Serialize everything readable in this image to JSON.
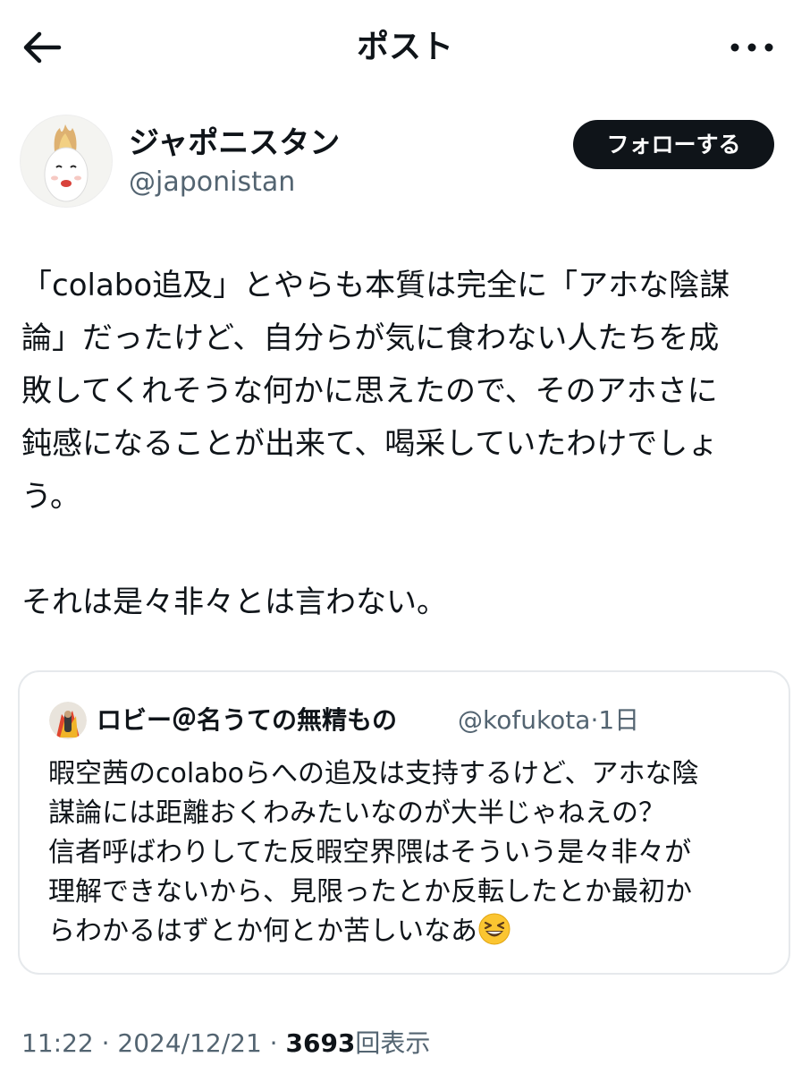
{
  "header": {
    "title": "ポスト",
    "back_icon": "arrow-left-icon",
    "more_icon": "more-horizontal-icon"
  },
  "author": {
    "name": "ジャポニスタン",
    "handle": "@japonistan",
    "follow_label": "フォローする"
  },
  "post": {
    "lines": [
      "「colabo追及」とやらも本質は完全に「アホな陰謀",
      "論」だったけど、自分らが気に食わない人たちを成",
      "敗してくれそうな何かに思えたので、そのアホさに",
      "鈍感になることが出来て、喝采していたわけでしょ",
      "う。",
      "それは是々非々とは言わない。"
    ]
  },
  "quote": {
    "name": "ロビー＠名うての無精もの",
    "handle": "@kofukota",
    "time": "·1日",
    "lines": [
      "暇空茜のcolaboらへの追及は支持するけど、アホな陰",
      "謀論には距離おくわみたいなのが大半じゃねえの？",
      "信者呼ばわりしてた反暇空界隈はそういう是々非々が",
      "理解できないから、見限ったとか反転したとか最初か",
      "らわかるはずとか何とか苦しいなあ"
    ],
    "emoji_icon": "grinning-squinting-face-icon"
  },
  "meta": {
    "time": "11:22 · 2024/12/21 · ",
    "views": "3693",
    "views_label": "回表示"
  },
  "colors": {
    "text": "#0f1419",
    "secondary": "#536471",
    "border": "#e6e9ec",
    "button": "#0f1419"
  }
}
